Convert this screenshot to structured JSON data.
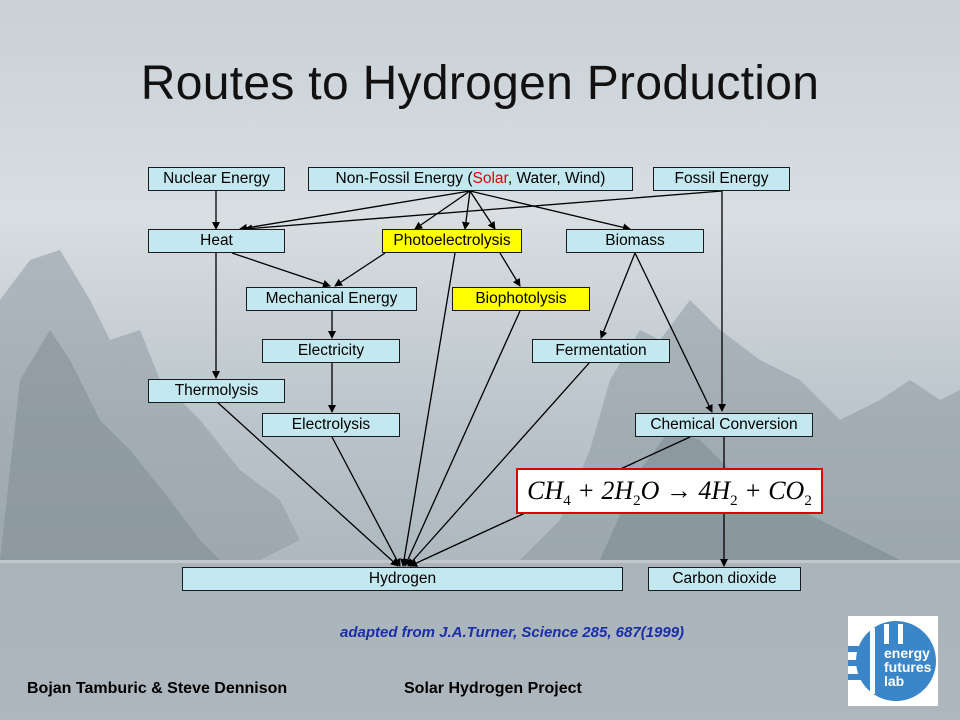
{
  "title": "Routes to Hydrogen Production",
  "nodes": {
    "nuclear": "Nuclear Energy",
    "nonfossil_pre": "Non-Fossil Energy (",
    "nonfossil_solar": "Solar",
    "nonfossil_post": ", Water, Wind)",
    "fossil": "Fossil Energy",
    "heat": "Heat",
    "photoelectrolysis": "Photoelectrolysis",
    "biomass": "Biomass",
    "mechanical": "Mechanical Energy",
    "biophotolysis": "Biophotolysis",
    "electricity": "Electricity",
    "fermentation": "Fermentation",
    "thermolysis": "Thermolysis",
    "electrolysis": "Electrolysis",
    "chemical": "Chemical Conversion",
    "hydrogen": "Hydrogen",
    "co2": "Carbon dioxide"
  },
  "equation": {
    "ch": "CH",
    "four_a": "4",
    "plus1": " + 2H",
    "two": "2",
    "o_arrow": "O → 4H",
    "two_b": "2",
    "plus2": " + CO",
    "two_c": "2"
  },
  "source": "adapted from J.A.Turner, Science 285, 687(1999)",
  "footer": {
    "authors": "Bojan Tamburic & Steve Dennison",
    "project": "Solar Hydrogen Project"
  },
  "logo": {
    "line1": "energy",
    "line2": "futures",
    "line3": "lab",
    "colors": {
      "blue": "#3a86c8",
      "white": "#ffffff"
    }
  },
  "colors": {
    "box_fill": "#c3e8ef",
    "highlight": "#ffff00",
    "solar": "#e00000",
    "source_text": "#1a2ea8"
  }
}
